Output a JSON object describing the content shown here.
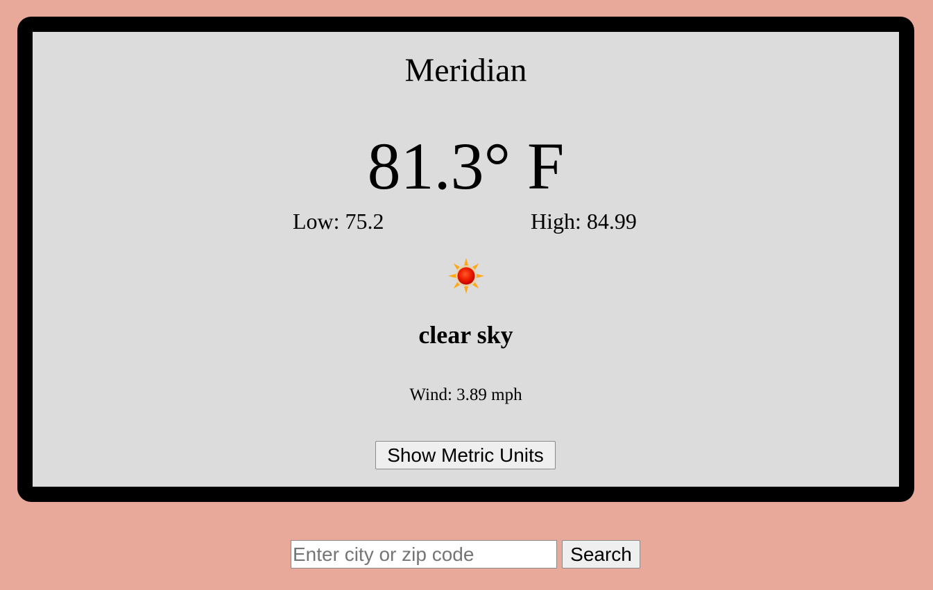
{
  "weather": {
    "city": "Meridian",
    "temperature": "81.3° F",
    "low": "Low: 75.2",
    "high": "High: 84.99",
    "icon": "sun-icon",
    "description": "clear sky",
    "wind": "Wind: 3.89 mph",
    "metric_button_label": "Show Metric Units"
  },
  "search": {
    "placeholder": "Enter city or zip code",
    "value": "",
    "button_label": "Search"
  },
  "colors": {
    "page_background": "#e8a99b",
    "card_background": "#dcdcdc",
    "card_border": "#000000"
  }
}
